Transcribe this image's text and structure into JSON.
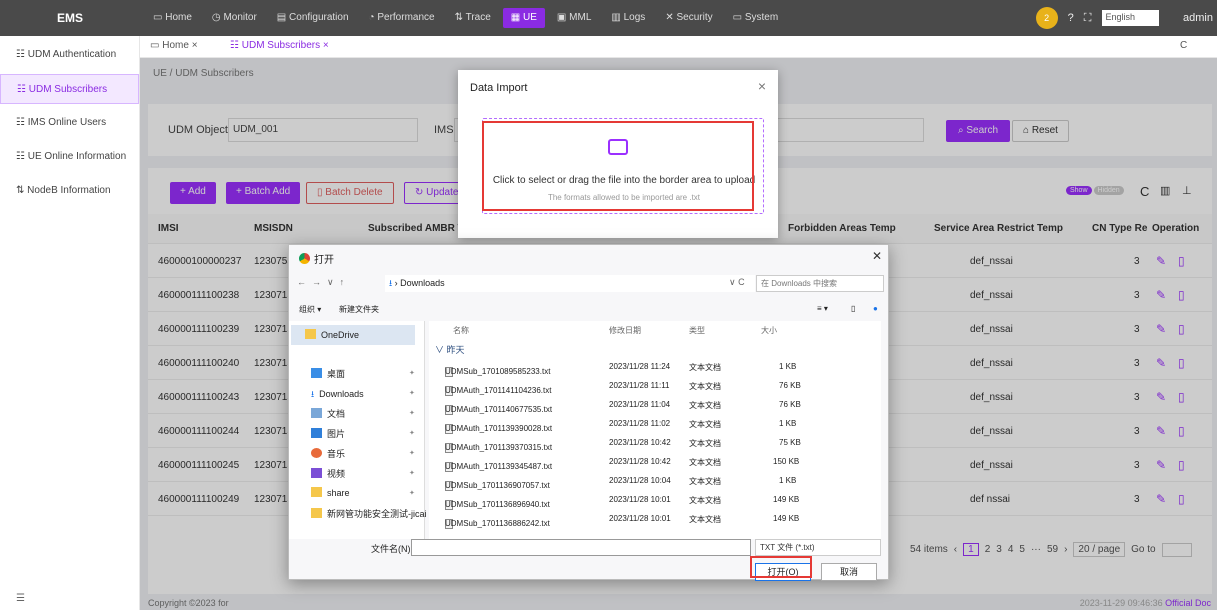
{
  "app": {
    "title": "EMS"
  },
  "nav": [
    "Home",
    "Monitor",
    "Configuration",
    "Performance",
    "Trace",
    "UE",
    "MML",
    "Logs",
    "Security",
    "System"
  ],
  "nav_active_index": 5,
  "topright": {
    "badge": "2",
    "language": "English",
    "user": "admin"
  },
  "sidebar": [
    {
      "label": "UDM Authentication"
    },
    {
      "label": "UDM Subscribers"
    },
    {
      "label": "IMS Online Users"
    },
    {
      "label": "UE Online Information"
    },
    {
      "label": "NodeB Information"
    }
  ],
  "tabs": {
    "home": "Home",
    "subscribers": "UDM Subscribers"
  },
  "breadcrumb": "UE / UDM Subscribers",
  "filter": {
    "udm_object_label": "UDM Object:",
    "udm_object_value": "UDM_001",
    "imsi_label": "IMSI:",
    "search": "Search",
    "reset": "Reset"
  },
  "toolbar": {
    "add": "+ Add",
    "batch_add": "+ Batch Add",
    "batch_delete": "Batch Delete",
    "updated": "Updated",
    "show": "Show",
    "hidden": "Hidden"
  },
  "table": {
    "columns": [
      "IMSI",
      "MSISDN",
      "Subscribed AMBR Tem",
      "Forbidden Areas Temp",
      "Service Area Restrict Temp",
      "CN Type Re",
      "Operation"
    ],
    "rows": [
      {
        "imsi": "460000100000237",
        "msisdn": "1230755",
        "sa": "def_nssai",
        "cn": "3"
      },
      {
        "imsi": "460000111100238",
        "msisdn": "1230715",
        "sa": "def_nssai",
        "cn": "3"
      },
      {
        "imsi": "460000111100239",
        "msisdn": "1230715",
        "sa": "def_nssai",
        "cn": "3"
      },
      {
        "imsi": "460000111100240",
        "msisdn": "1230715",
        "sa": "def_nssai",
        "cn": "3"
      },
      {
        "imsi": "460000111100243",
        "msisdn": "1230715",
        "sa": "def_nssai",
        "cn": "3"
      },
      {
        "imsi": "460000111100244",
        "msisdn": "1230715",
        "sa": "def_nssai",
        "cn": "3"
      },
      {
        "imsi": "460000111100245",
        "msisdn": "1230715",
        "sa": "def_nssai",
        "cn": "3"
      },
      {
        "imsi": "460000111100249",
        "msisdn": "1230715",
        "sa": "def nssai",
        "cn": "3"
      }
    ]
  },
  "pager": {
    "total": "54 items",
    "pages": [
      "1",
      "2",
      "3",
      "4",
      "5",
      "···",
      "59"
    ],
    "page_size": "20 / page",
    "goto": "Go to"
  },
  "footer": {
    "copyright": "Copyright ©2023 for",
    "datetime": "2023-11-29 09:46:36",
    "official": "Official",
    "doc": "Doc"
  },
  "modal": {
    "title": "Data Import",
    "upload_text": "Click to select or drag the file into the border area to upload",
    "upload_hint": "The formats allowed to be imported are .txt"
  },
  "file_dialog": {
    "title": "打开",
    "path": "Downloads",
    "search_placeholder": "在 Downloads 中搜索",
    "organize": "组织 ▾",
    "new_folder": "新建文件夹",
    "nav": [
      {
        "label": "OneDrive"
      },
      {
        "label": "桌面"
      },
      {
        "label": "Downloads"
      },
      {
        "label": "文档"
      },
      {
        "label": "图片"
      },
      {
        "label": "音乐"
      },
      {
        "label": "视频"
      },
      {
        "label": "share"
      },
      {
        "label": "新网管功能安全测试-jicai"
      }
    ],
    "columns": [
      "名称",
      "修改日期",
      "类型",
      "大小"
    ],
    "group": "昨天",
    "files": [
      {
        "name": "UDMSub_1701089585233.txt",
        "date": "2023/11/28 11:24",
        "type": "文本文档",
        "size": "1 KB"
      },
      {
        "name": "UDMAuth_1701141104236.txt",
        "date": "2023/11/28 11:11",
        "type": "文本文档",
        "size": "76 KB"
      },
      {
        "name": "UDMAuth_1701140677535.txt",
        "date": "2023/11/28 11:04",
        "type": "文本文档",
        "size": "76 KB"
      },
      {
        "name": "UDMAuth_1701139390028.txt",
        "date": "2023/11/28 11:02",
        "type": "文本文档",
        "size": "1 KB"
      },
      {
        "name": "UDMAuth_1701139370315.txt",
        "date": "2023/11/28 10:42",
        "type": "文本文档",
        "size": "75 KB"
      },
      {
        "name": "UDMAuth_1701139345487.txt",
        "date": "2023/11/28 10:42",
        "type": "文本文档",
        "size": "150 KB"
      },
      {
        "name": "UDMSub_1701136907057.txt",
        "date": "2023/11/28 10:04",
        "type": "文本文档",
        "size": "1 KB"
      },
      {
        "name": "UDMSub_1701136896940.txt",
        "date": "2023/11/28 10:01",
        "type": "文本文档",
        "size": "149 KB"
      },
      {
        "name": "UDMSub_1701136886242.txt",
        "date": "2023/11/28 10:01",
        "type": "文本文档",
        "size": "149 KB"
      }
    ],
    "filename_label": "文件名(N):",
    "filetype": "TXT 文件 (*.txt)",
    "open": "打开(O)",
    "cancel": "取消"
  },
  "colors": {
    "accent": "#9b30ff",
    "highlight": "#e53935",
    "topbar": "#4a4a4a"
  }
}
